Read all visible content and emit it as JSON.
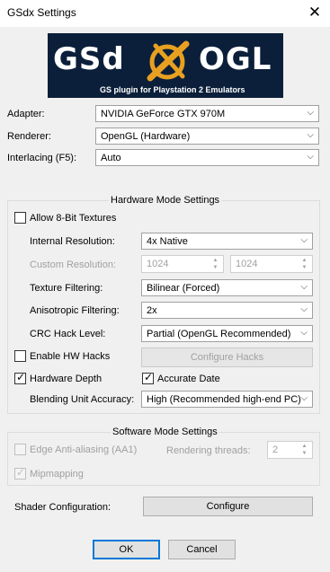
{
  "window": {
    "title": "GSdx Settings",
    "close_glyph": "✕"
  },
  "logo": {
    "left_text": "GSd",
    "right_text": "OGL",
    "subtitle": "GS plugin   for Playstation 2 Emulators"
  },
  "main": {
    "adapter": {
      "label": "Adapter:",
      "value": "NVIDIA GeForce GTX 970M"
    },
    "renderer": {
      "label": "Renderer:",
      "value": "OpenGL (Hardware)"
    },
    "interlacing": {
      "label": "Interlacing (F5):",
      "value": "Auto"
    }
  },
  "hardware": {
    "title": "Hardware Mode Settings",
    "allow8bit": {
      "label": "Allow 8-Bit Textures",
      "checked": false
    },
    "internal_res": {
      "label": "Internal Resolution:",
      "value": "4x Native"
    },
    "custom_res": {
      "label": "Custom Resolution:",
      "w": "1024",
      "h": "1024"
    },
    "texture_filtering": {
      "label": "Texture Filtering:",
      "value": "Bilinear (Forced)"
    },
    "aniso": {
      "label": "Anisotropic Filtering:",
      "value": "2x"
    },
    "crc": {
      "label": "CRC Hack Level:",
      "value": "Partial (OpenGL Recommended)"
    },
    "hw_hacks": {
      "label": "Enable HW Hacks",
      "checked": false
    },
    "configure_hacks": "Configure Hacks",
    "hardware_depth": {
      "label": "Hardware Depth",
      "checked": true
    },
    "accurate_date": {
      "label": "Accurate Date",
      "checked": true
    },
    "blending": {
      "label": "Blending Unit Accuracy:",
      "value": "High (Recommended high-end PC)"
    }
  },
  "software": {
    "title": "Software Mode Settings",
    "edge_aa": {
      "label": "Edge Anti-aliasing (AA1)",
      "checked": false
    },
    "threads": {
      "label": "Rendering threads:",
      "value": "2"
    },
    "mipmapping": {
      "label": "Mipmapping",
      "checked": true
    }
  },
  "shader": {
    "label": "Shader Configuration:",
    "button": "Configure"
  },
  "footer": {
    "ok": "OK",
    "cancel": "Cancel"
  },
  "glyphs": {
    "dropdown": "⌵",
    "check": "✓",
    "up": "▲",
    "down": "▼"
  },
  "colors": {
    "accent": "#0078d7",
    "logo_bg": "#0b1f3a",
    "logo_emblem": "#e8a020"
  }
}
